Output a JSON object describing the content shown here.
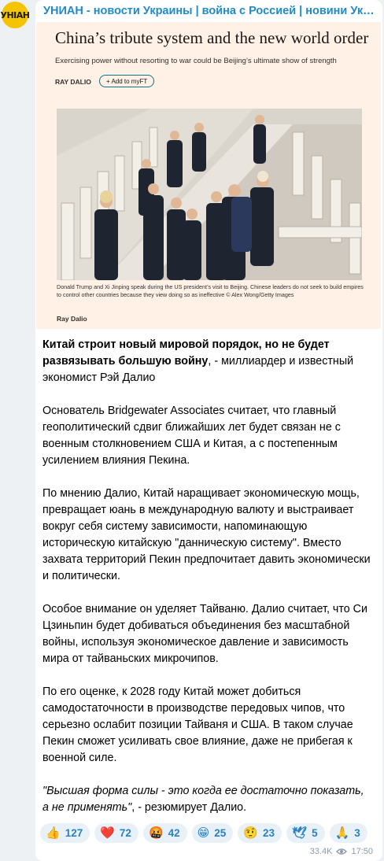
{
  "channel": {
    "avatar_text": "УНІАН",
    "name": "УНИАН - новости Украины | война с Россией | новини Україні..."
  },
  "ft": {
    "title": "China’s tribute system and the new world order",
    "subtitle": "Exercising power without resorting to war could be Beijing’s ultimate show of strength",
    "author": "RAY DALIO",
    "add_button": "+ Add to myFT",
    "caption": "Donald Trump and Xi Jinping speak during the US president’s visit to Beijing. Chinese leaders do not seek to build empires to control other countries because they view doing so as ineffective © Alex Wong/Getty Images",
    "footer": "Ray Dalio"
  },
  "post": {
    "p1_bold": "Китай строит новый мировой порядок, но не будет развязывать большую войну",
    "p1_rest": ", - миллиардер и известный экономист Рэй Далио",
    "p2": "Основатель Bridgewater Associates считает, что главный геополитический сдвиг ближайших лет будет связан не с военным столкновением США и Китая, а с постепенным усилением влияния Пекина.",
    "p3": "По мнению Далио, Китай наращивает экономическую мощь, превращает юань в международную валюту и выстраивает вокруг себя систему зависимости, напоминающую историческую китайскую \"данническую систему\". Вместо захвата территорий Пекин предпочитает давить экономически и политически.",
    "p4": "Особое внимание он уделяет Тайваню. Далио считает, что Си Цзиньпин будет добиваться объединения без масштабной войны, используя экономическое давление и зависимость мира от тайваньских микрочипов.",
    "p5": "По его оценке, к 2028 году Китай может добиться самодостаточности в производстве передовых чипов, что серьезно ослабит позиции Тайваня и США. В таком случае Пекин сможет усиливать свое влияние, даже не прибегая к военной силе.",
    "quote_italic": "\"Высшая форма силы - это когда ее достаточно показать, а не применять\"",
    "quote_rest": ", - резюмирует Далио."
  },
  "reactions": [
    {
      "emoji": "👍",
      "count": "127"
    },
    {
      "emoji": "❤️",
      "count": "72"
    },
    {
      "emoji": "🤬",
      "count": "42"
    },
    {
      "emoji": "😁",
      "count": "25"
    },
    {
      "emoji": "🤨",
      "count": "23"
    },
    {
      "emoji": "🕊",
      "count": "5"
    },
    {
      "emoji": "🙏",
      "count": "3"
    }
  ],
  "meta": {
    "views": "33.4K",
    "time": "17:50"
  },
  "colors": {
    "link": "#1f8ac9",
    "ft_background": "#fff1e5",
    "reaction_bg": "#e9f1f8",
    "avatar_bg": "#f5c400"
  }
}
